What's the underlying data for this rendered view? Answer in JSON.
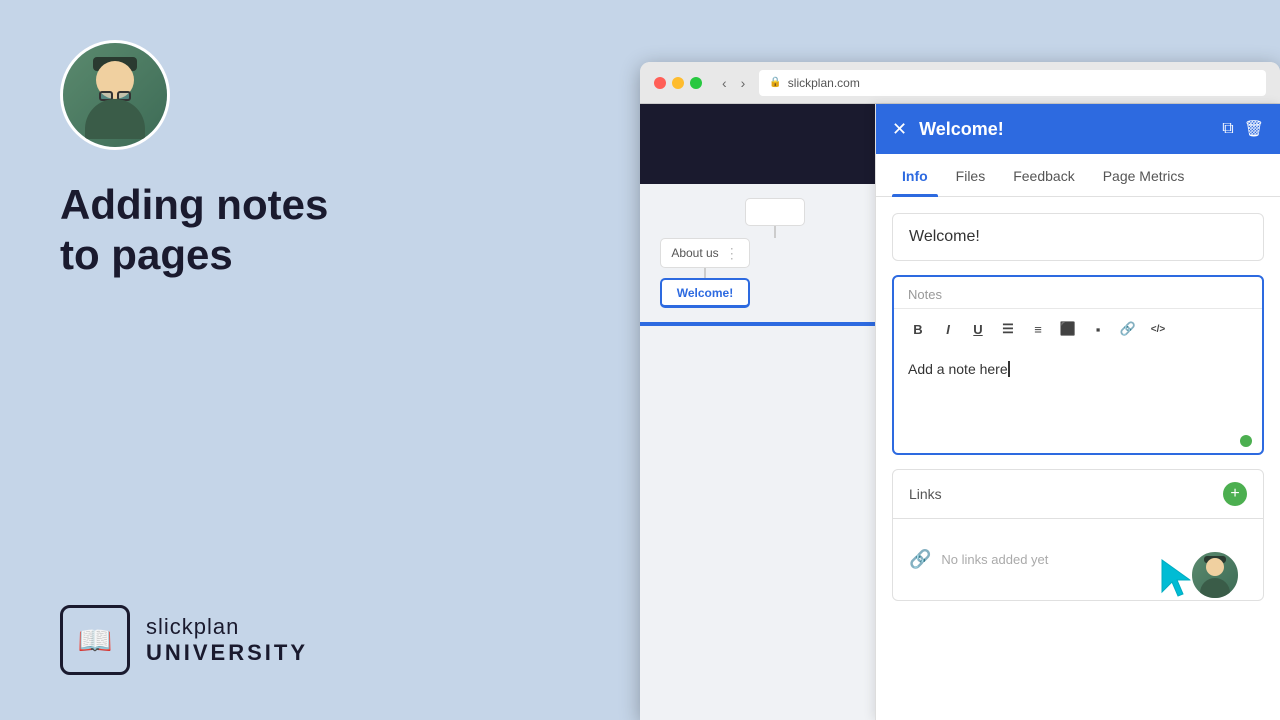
{
  "left": {
    "headline_line1": "Adding notes",
    "headline_line2": "to pages"
  },
  "logo": {
    "slickplan": "slickplan",
    "university": "UNIVERSITY"
  },
  "browser": {
    "url": "slickplan.com",
    "lock_icon": "🔒"
  },
  "panel": {
    "title": "Welcome!",
    "close_icon": "✕",
    "copy_icon": "⧉",
    "delete_icon": "🗑",
    "tabs": [
      {
        "label": "Info",
        "active": true
      },
      {
        "label": "Files",
        "active": false
      },
      {
        "label": "Feedback",
        "active": false
      },
      {
        "label": "Page Metrics",
        "active": false
      }
    ],
    "page_name": "Welcome!",
    "notes_label": "Notes",
    "notes_placeholder": "Add a note here",
    "notes_content": "Add a note here",
    "toolbar": {
      "bold": "B",
      "italic": "I",
      "underline": "U",
      "bullet_list": "≡",
      "ordered_list": "≡",
      "align_left": "≡",
      "align_right": "≡",
      "link": "🔗",
      "code": "</>"
    },
    "links_label": "Links",
    "add_link_icon": "+",
    "no_links_text": "No links added yet",
    "link_icon": "🔗"
  },
  "sitemap": {
    "about_us_label": "About us",
    "welcome_label": "Welcome!"
  }
}
